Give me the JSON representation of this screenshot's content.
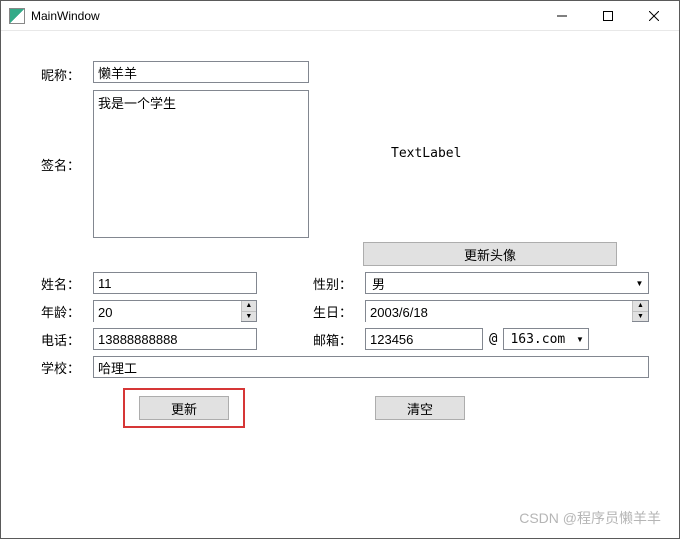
{
  "window": {
    "title": "MainWindow"
  },
  "labels": {
    "nickname": "昵称：",
    "signature": "签名：",
    "name": "姓名：",
    "gender": "性别：",
    "age": "年龄：",
    "birthday": "生日：",
    "phone": "电话：",
    "email": "邮箱：",
    "school": "学校：",
    "textlabel": "TextLabel"
  },
  "values": {
    "nickname": "懒羊羊",
    "signature": "我是一个学生",
    "name": "11",
    "gender": "男",
    "age": "20",
    "birthday": "2003/6/18",
    "phone": "13888888888",
    "email_user": "123456",
    "email_at": "@",
    "email_domain": "163.com",
    "school": "哈理工"
  },
  "buttons": {
    "update_avatar": "更新头像",
    "update": "更新",
    "clear": "清空"
  },
  "watermark": "CSDN @程序员懒羊羊"
}
